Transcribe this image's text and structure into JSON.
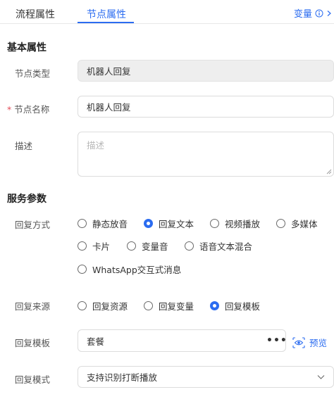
{
  "tabs": [
    {
      "label": "流程属性"
    },
    {
      "label": "节点属性"
    }
  ],
  "variables_link": "变量",
  "basic": {
    "title": "基本属性",
    "node_type": {
      "label": "节点类型",
      "value": "机器人回复"
    },
    "node_name": {
      "required_mark": "*",
      "label": "节点名称",
      "value": "机器人回复"
    },
    "description": {
      "label": "描述",
      "placeholder": "描述"
    }
  },
  "service": {
    "title": "服务参数",
    "reply_method": {
      "label": "回复方式",
      "options": [
        "静态放音",
        "回复文本",
        "视频播放",
        "多媒体",
        "卡片",
        "变量音",
        "语音文本混合",
        "WhatsApp交互式消息"
      ],
      "selected": "回复文本"
    },
    "reply_source": {
      "label": "回复来源",
      "options": [
        "回复资源",
        "回复变量",
        "回复模板"
      ],
      "selected": "回复模板"
    },
    "reply_template": {
      "label": "回复模板",
      "value": "套餐",
      "more": "•••",
      "preview": "预览"
    },
    "reply_mode": {
      "label": "回复模式",
      "value": "支持识别打断播放"
    }
  },
  "colors": {
    "accent": "#2b6cf0",
    "required": "#e34d59"
  }
}
